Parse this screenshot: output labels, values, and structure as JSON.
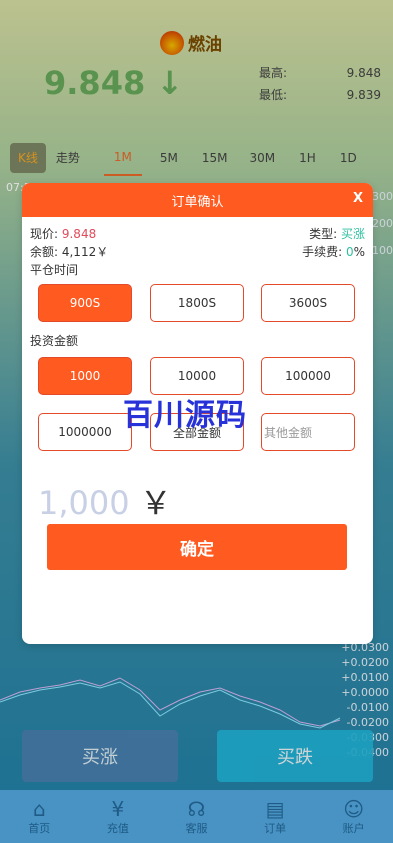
{
  "header": {
    "brand": "燃油",
    "price": "9.848",
    "arrow": "↓",
    "high_label": "最高:",
    "high_value": "9.848",
    "low_label": "最低:",
    "low_value": "9.839"
  },
  "tabs": [
    "K线",
    "走势",
    "1M",
    "5M",
    "15M",
    "30M",
    "1H",
    "1D"
  ],
  "chart": {
    "time": "07:5",
    "right_ticks": [
      "0.0300",
      "0.0200",
      "0.0100",
      "",
      "",
      "",
      "",
      "",
      "",
      ""
    ],
    "bottom_ticks": [
      "+0.0300",
      "+0.0200",
      "+0.0100",
      "+0.0000",
      "-0.0100",
      "-0.0200",
      "-0.0300",
      "-0.0400"
    ]
  },
  "modal": {
    "title": "订单确认",
    "close": "X",
    "price_label": "现价: ",
    "price_value": "9.848",
    "type_label": "类型: ",
    "type_value": "买涨",
    "balance_label": "余额: ",
    "balance_value": "4,112￥",
    "fee_label": "手续费: ",
    "fee_value": "0",
    "fee_unit": "%",
    "close_time_label": "平仓时间",
    "times": [
      "900S",
      "1800S",
      "3600S"
    ],
    "invest_label": "投资金额",
    "amounts": [
      "1000",
      "10000",
      "100000",
      "1000000",
      "全部金额"
    ],
    "other_placeholder": "其他金额",
    "amount_display": "1,000",
    "yen": "￥",
    "confirm": "确定"
  },
  "actions": {
    "buy_up": "买涨",
    "buy_down": "买跌"
  },
  "watermark": "百川源码",
  "nav": [
    {
      "label": "首页",
      "icon": "home-icon",
      "glyph": "⌂"
    },
    {
      "label": "充值",
      "icon": "coin-icon",
      "glyph": "¥"
    },
    {
      "label": "客服",
      "icon": "headset-icon",
      "glyph": "☊"
    },
    {
      "label": "订单",
      "icon": "document-icon",
      "glyph": "▤"
    },
    {
      "label": "账户",
      "icon": "user-icon",
      "glyph": "☺"
    }
  ]
}
